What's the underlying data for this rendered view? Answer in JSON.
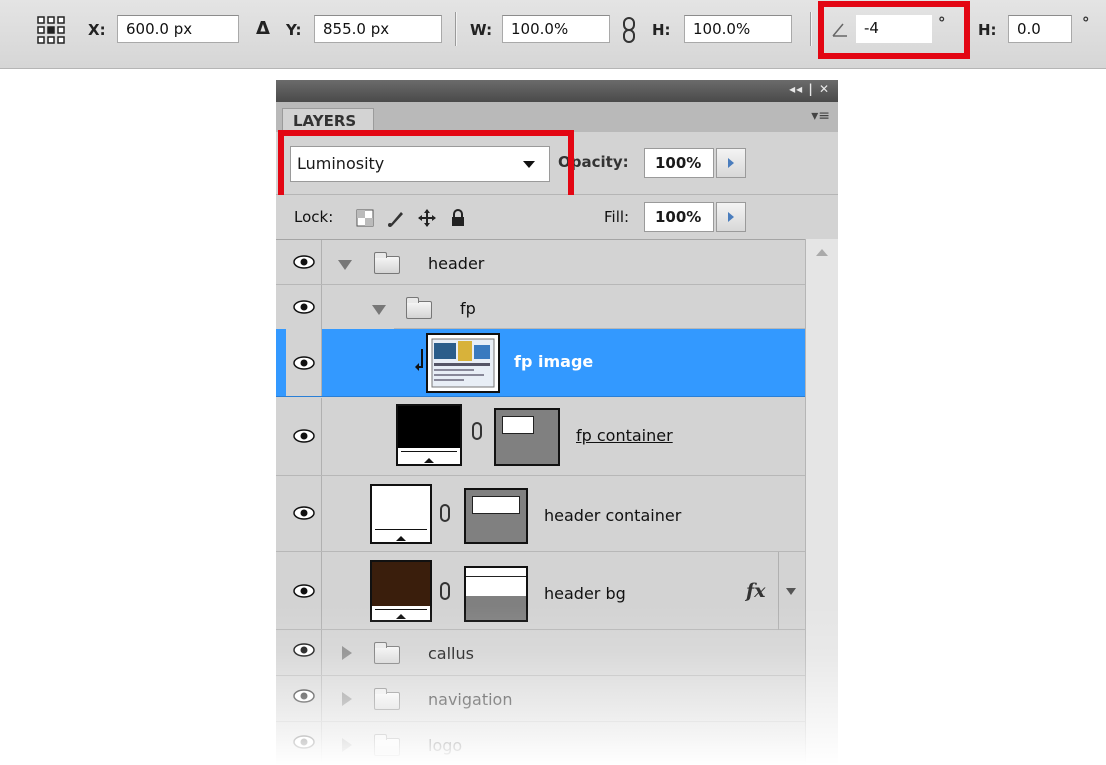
{
  "options_bar": {
    "x_label": "X:",
    "x_value": "600.0 px",
    "delta_symbol": "Δ",
    "y_label": "Y:",
    "y_value": "855.0 px",
    "w_label": "W:",
    "w_value": "100.0%",
    "h_label": "H:",
    "h_value": "100.0%",
    "angle_value": "-4",
    "degree_symbol": "°",
    "skew_h_label": "H:",
    "skew_h_value": "0.0",
    "reference_point_icon": "reference-point-grid-icon",
    "link_icon": "chain-link-icon",
    "angle_icon": "angle-icon"
  },
  "highlight_color": "#e30613",
  "layers_panel": {
    "tab_label": "LAYERS",
    "title_controls": "◂◂ | ✕",
    "menu_icon": "panel-menu-icon",
    "blend_mode": "Luminosity",
    "opacity_label": "Opacity:",
    "opacity_value": "100%",
    "lock_label": "Lock:",
    "fill_label": "Fill:",
    "fill_value": "100%",
    "selected_color": "#3399ff",
    "layers": [
      {
        "name": "header",
        "kind": "group",
        "expanded": true
      },
      {
        "name": "fp",
        "kind": "group",
        "expanded": true
      },
      {
        "name": "fp image",
        "kind": "clipped-image",
        "selected": true
      },
      {
        "name": "fp container",
        "kind": "masked-layer",
        "swatch": "#000000"
      },
      {
        "name": "header container",
        "kind": "masked-layer",
        "swatch": "#ffffff"
      },
      {
        "name": "header bg",
        "kind": "masked-layer",
        "swatch": "#3a1e0c",
        "fx": "fx"
      },
      {
        "name": "callus",
        "kind": "group",
        "expanded": false
      },
      {
        "name": "navigation",
        "kind": "group",
        "expanded": false
      },
      {
        "name": "logo",
        "kind": "group",
        "expanded": false
      }
    ]
  }
}
